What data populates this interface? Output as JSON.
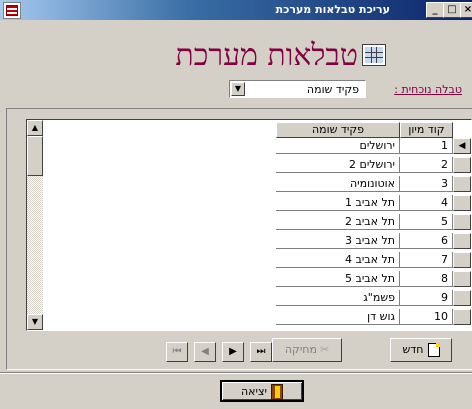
{
  "window": {
    "title": "עריכת טבלאות מערכת"
  },
  "heading": {
    "text": "טבלאות מערכת"
  },
  "current_table": {
    "label": "טבלה נוכחית :",
    "value": "פקיד שומה"
  },
  "grid": {
    "columns": [
      "קוד מיון",
      "פקיד שומה"
    ],
    "rows": [
      {
        "code": "1",
        "name": "ירושלים"
      },
      {
        "code": "2",
        "name": "ירושלים 2"
      },
      {
        "code": "3",
        "name": "אוטונומיה"
      },
      {
        "code": "4",
        "name": "תל אביב 1"
      },
      {
        "code": "5",
        "name": "תל אביב 2"
      },
      {
        "code": "6",
        "name": "תל אביב 3"
      },
      {
        "code": "7",
        "name": "תל אביב 4"
      },
      {
        "code": "8",
        "name": "תל אביב 5"
      },
      {
        "code": "9",
        "name": "פשמ\"ג"
      },
      {
        "code": "10",
        "name": "גוש דן"
      }
    ]
  },
  "buttons": {
    "new": "חדש",
    "delete": "מחיקה",
    "exit": "יציאה"
  },
  "nav": {
    "first": "⏮",
    "prev": "◀",
    "next": "▶",
    "last": "⏭"
  }
}
